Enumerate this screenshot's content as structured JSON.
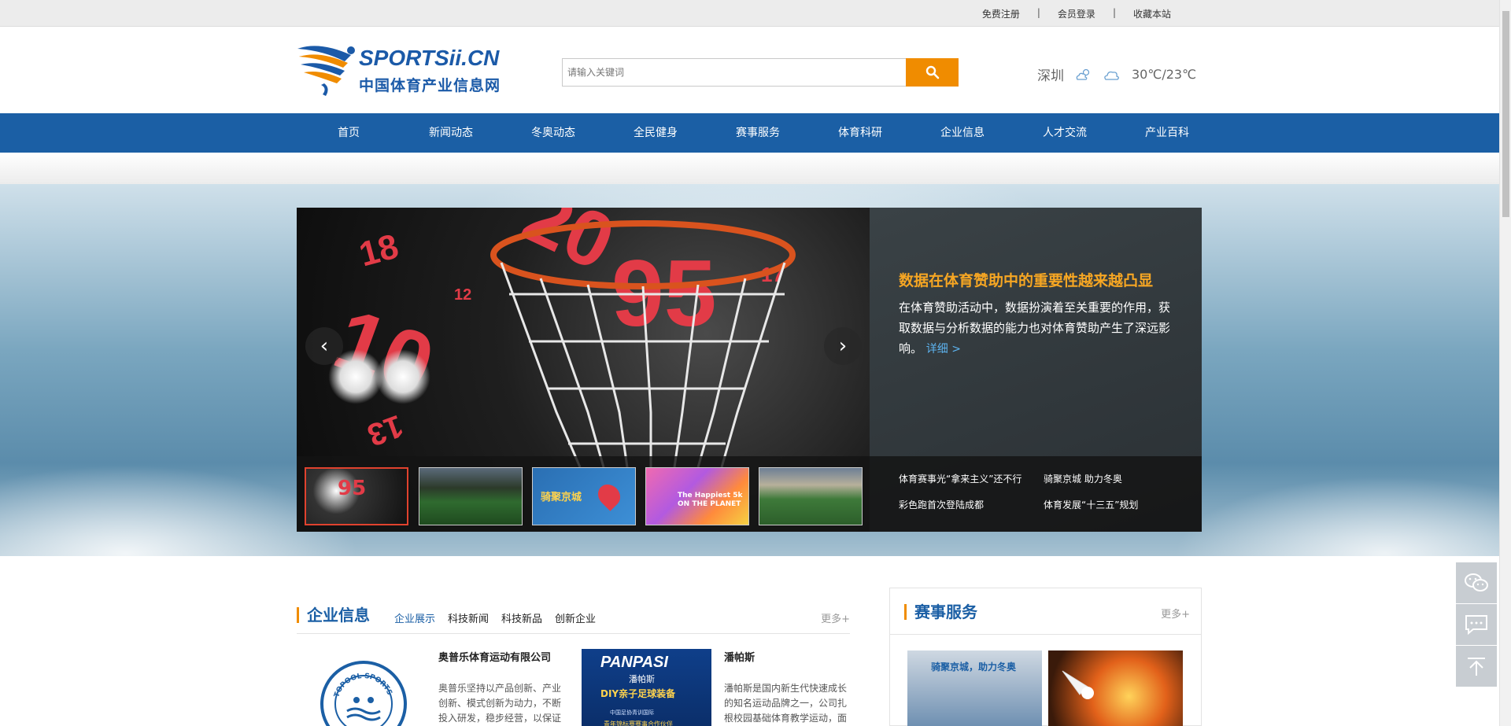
{
  "topbar": {
    "register": "免费注册",
    "login": "会员登录",
    "bookmark": "收藏本站",
    "sep": "|"
  },
  "logo": {
    "en": "SPORTSii.CN",
    "cn": "中国体育产业信息网"
  },
  "search": {
    "placeholder": "请输入关键词",
    "icon": "search-icon"
  },
  "weather": {
    "city": "深圳",
    "temp": "30℃/23℃",
    "icons": [
      "partly-cloudy-icon",
      "cloud-icon"
    ]
  },
  "nav": {
    "items": [
      "首页",
      "新闻动态",
      "冬奥动态",
      "全民健身",
      "赛事服务",
      "体育科研",
      "企业信息",
      "人才交流",
      "产业百科"
    ]
  },
  "hero": {
    "title": "数据在体育赞助中的重要性越来越凸显",
    "desc": "在体育赞助活动中，数据扮演着至关重要的作用，获取数据与分析数据的能力也对体育赞助产生了深远影响。",
    "more": "详细 >",
    "links": [
      "体育赛事光“拿来主义”还不行",
      "骑聚京城 助力冬奥",
      "彩色跑首次登陆成都",
      "体育发展“十三五”规划"
    ],
    "thumb_texts": [
      "",
      "",
      "骑聚京城",
      "The Happiest 5k ON THE PLANET",
      ""
    ]
  },
  "company": {
    "title": "企业信息",
    "tabs": [
      "企业展示",
      "科技新闻",
      "科技新品",
      "创新企业"
    ],
    "more": "更多+",
    "cards": [
      {
        "name": "奥普乐体育运动有限公司",
        "desc": "奥普乐坚持以产品创新、产业创新、模式创新为动力，不断投入研发，稳步经营，以保证产品的高品质和领先，详",
        "logo_text": "TOPOOL SPORTS"
      },
      {
        "name": "潘帕斯",
        "desc": "潘帕斯是国内新生代快速成长的知名运动品牌之一，公司扎根校园基础体育教学运动，面向广大青少年，长期致力，详",
        "logo_text": "PANPASI",
        "logo_sub": "潘帕斯",
        "banner1": "DIY亲子足球装备",
        "banner2": "中国足协青训国际",
        "banner3": "青年锦标赛赛事合作伙伴"
      }
    ]
  },
  "events": {
    "title": "赛事服务",
    "more": "更多+",
    "img1_text": "骑聚京城，助力冬奥"
  },
  "colors": {
    "brand": "#1b5fa5",
    "accent": "#f08c00",
    "hero_title": "#f6a623"
  }
}
